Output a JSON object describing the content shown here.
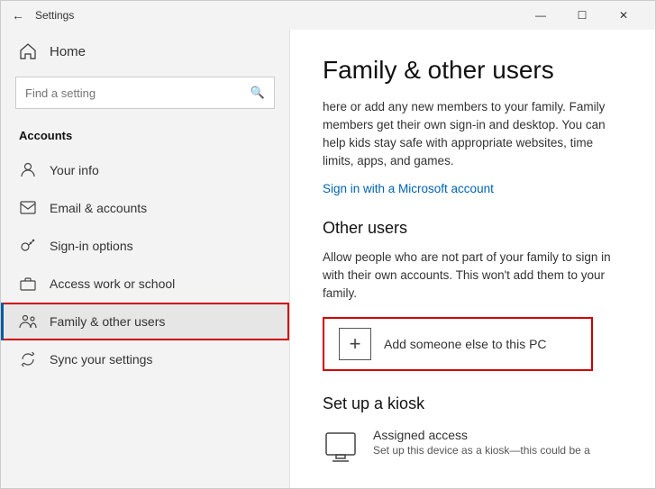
{
  "window": {
    "title": "Settings",
    "back_label": "←",
    "controls": [
      "—",
      "☐",
      "✕"
    ]
  },
  "sidebar": {
    "home_label": "Home",
    "search_placeholder": "Find a setting",
    "section_title": "Accounts",
    "nav_items": [
      {
        "id": "your-info",
        "label": "Your info",
        "icon": "person"
      },
      {
        "id": "email-accounts",
        "label": "Email & accounts",
        "icon": "email"
      },
      {
        "id": "sign-in-options",
        "label": "Sign-in options",
        "icon": "key"
      },
      {
        "id": "access-work-school",
        "label": "Access work or school",
        "icon": "briefcase"
      },
      {
        "id": "family-other-users",
        "label": "Family & other users",
        "icon": "family",
        "active": true,
        "highlighted": true
      },
      {
        "id": "sync-settings",
        "label": "Sync your settings",
        "icon": "sync"
      }
    ]
  },
  "main": {
    "title": "Family & other users",
    "description": "here or add any new members to your family. Family members get their own sign-in and desktop. You can help kids stay safe with appropriate websites, time limits, apps, and games.",
    "link_label": "Sign in with a Microsoft account",
    "other_users_title": "Other users",
    "other_users_desc": "Allow people who are not part of your family to sign in with their own accounts. This won't add them to your family.",
    "add_user_label": "Add someone else to this PC",
    "kiosk_title": "Set up a kiosk",
    "kiosk_item_title": "Assigned access",
    "kiosk_item_desc": "Set up this device as a kiosk—this could be a"
  },
  "colors": {
    "accent": "#0063b1",
    "active_border": "#005a9e",
    "highlight_border": "#d00000",
    "sidebar_bg": "#f3f3f3"
  }
}
